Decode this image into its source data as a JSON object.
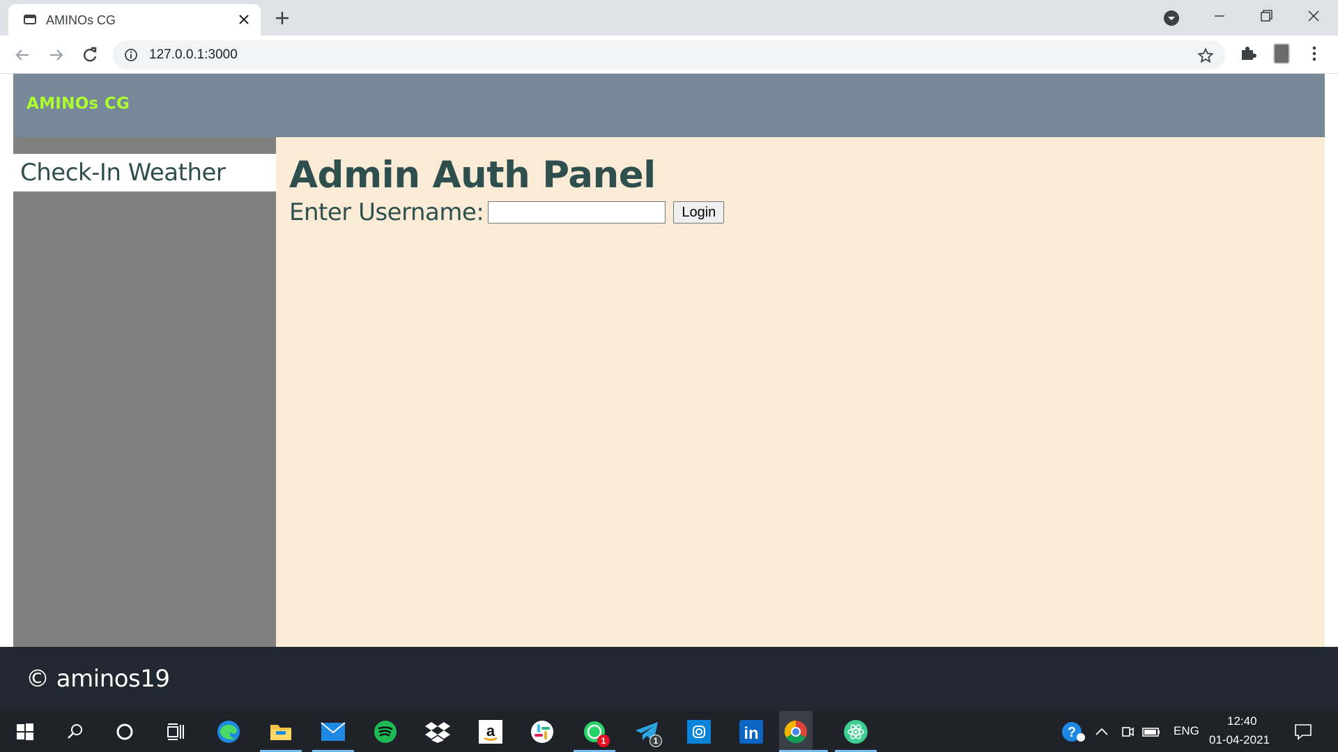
{
  "browser": {
    "tab_title": "AMINOs CG",
    "url": "127.0.0.1:3000",
    "new_tab_symbol": "+",
    "close_symbol": "✕"
  },
  "site": {
    "brand": "AMINOs CG",
    "sidebar": {
      "items": [
        {
          "label": "Check-In Weather"
        }
      ]
    },
    "main": {
      "title": "Admin Auth Panel",
      "username_label": "Enter Username:",
      "username_value": "",
      "login_label": "Login"
    },
    "footer": {
      "copyright": "© aminos19"
    }
  },
  "colors": {
    "header_bg": "#778899",
    "brand": "#adff2f",
    "sidebar_bg": "#808080",
    "main_bg": "#faebd7",
    "text_dark": "#2f4f4f",
    "footer_bg": "#222831",
    "taskbar_bg": "#1f2329"
  },
  "taskbar": {
    "icons": [
      "windows-start-icon",
      "search-icon",
      "cortana-icon",
      "task-view-icon",
      "edge-icon",
      "file-explorer-icon",
      "mail-icon",
      "spotify-icon",
      "dropbox-icon",
      "amazon-icon",
      "slack-icon",
      "whatsapp-icon",
      "telegram-icon",
      "instagram-icon",
      "linkedin-icon",
      "chrome-icon",
      "atom-icon"
    ],
    "whatsapp_badge": "1",
    "telegram_badge": "1",
    "language": "ENG",
    "time": "12:40",
    "date": "01-04-2021"
  }
}
